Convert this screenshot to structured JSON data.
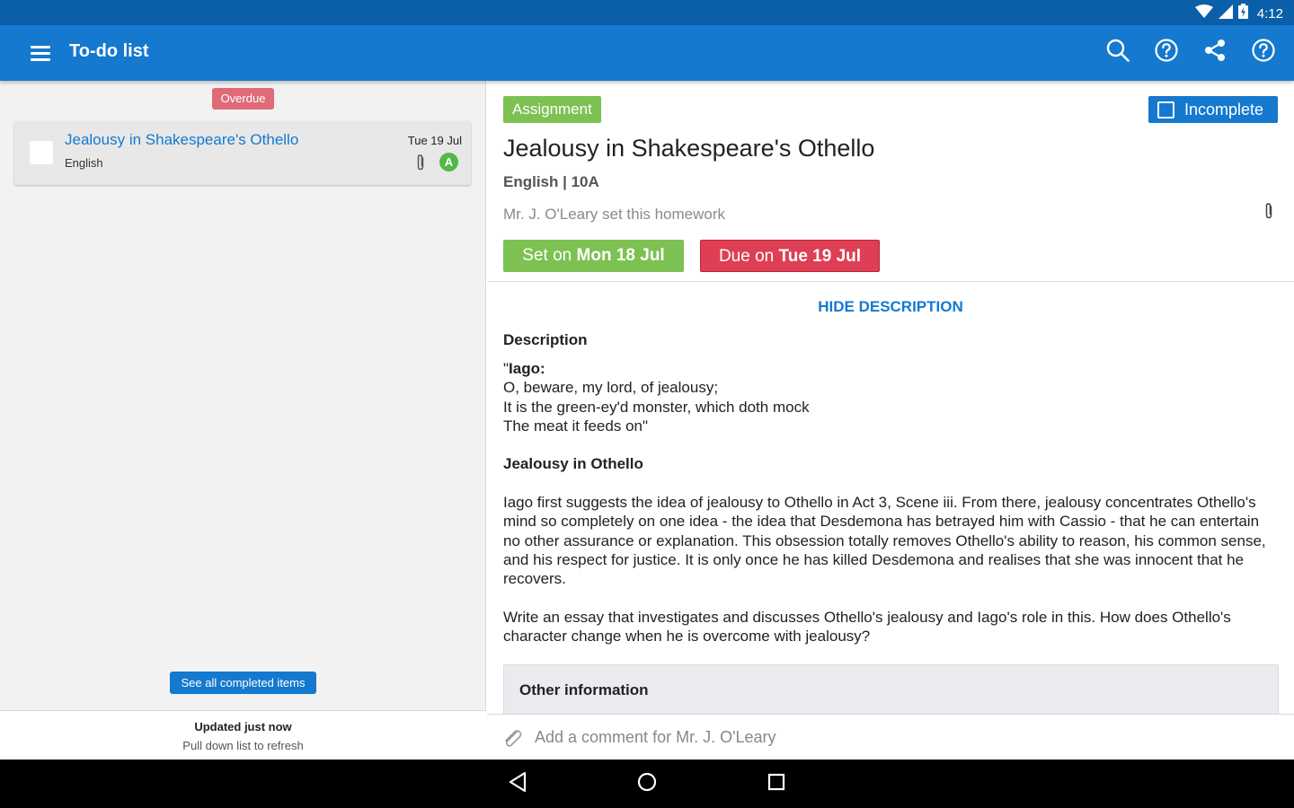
{
  "status_bar": {
    "time": "4:12",
    "icons": [
      "wifi-icon",
      "signal-icon",
      "battery-icon"
    ]
  },
  "app_bar": {
    "title": "To-do list",
    "actions": [
      "search-icon",
      "help-icon",
      "share-icon",
      "help-icon"
    ]
  },
  "todo_list": {
    "group_label": "Overdue",
    "items": [
      {
        "title": "Jealousy in Shakespeare's Othello",
        "subject": "English",
        "date": "Tue 19 Jul",
        "grade": "A",
        "has_attachment": true,
        "checked": false
      }
    ],
    "see_completed_label": "See all completed items",
    "updated_text": "Updated just now",
    "refresh_hint": "Pull down list to refresh"
  },
  "detail": {
    "type": "Assignment",
    "status_label": "Incomplete",
    "title": "Jealousy in Shakespeare's Othello",
    "subject_class": "English | 10A",
    "set_by": "Mr. J. O'Leary set this homework",
    "set_on_prefix": "Set on",
    "set_on_date": "Mon 18 Jul",
    "due_on_prefix": "Due on",
    "due_on_date": "Tue 19 Jul",
    "hide_description_label": "HIDE DESCRIPTION",
    "description_heading": "Description",
    "quote_open": "\"",
    "quote_speaker": "Iago:",
    "quote_line1": "O, beware, my lord, of jealousy;",
    "quote_line2": "It is the green-ey'd monster, which doth mock",
    "quote_line3": "The meat it feeds on\"",
    "section_heading": "Jealousy in Othello",
    "paragraph1": "Iago first suggests the idea of jealousy to Othello in Act 3, Scene iii. From there, jealousy concentrates Othello's mind so completely on one idea - the idea that Desdemona has betrayed him with Cassio - that he can entertain no other assurance or explanation. This obsession totally removes Othello's ability to reason, his common sense, and his respect for justice. It is only once he has killed Desdemona and realises that she was innocent that he recovers.",
    "paragraph2": "Write an essay that investigates and discusses Othello's jealousy and Iago's role in this. How does Othello's character change when he is overcome with jealousy?",
    "other_information_label": "Other information"
  },
  "comment": {
    "placeholder": "Add a comment for Mr. J. O'Leary"
  },
  "nav_bar": {
    "buttons": [
      "back-icon",
      "home-icon",
      "recents-icon"
    ]
  },
  "colors": {
    "status_bar": "#0a5fa8",
    "app_bar": "#1479cf",
    "accent": "#1479cf",
    "overdue": "#e06a78",
    "assignment": "#7cc152",
    "set_on": "#7cc152",
    "due_on": "#de3f54",
    "grade": "#52b848"
  }
}
